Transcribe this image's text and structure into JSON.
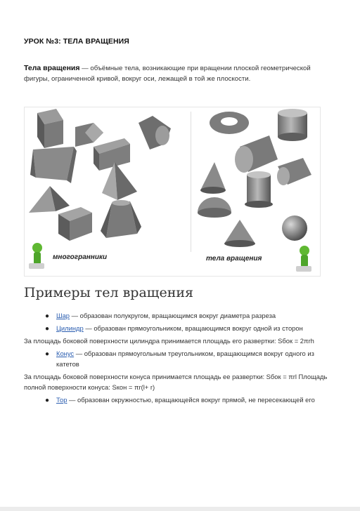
{
  "lesson_title": "УРОК №3: ТЕЛА ВРАЩЕНИЯ",
  "intro": {
    "term": "Тела вращения",
    "definition": " — объёмные тела, возникающие при вращении плоской геометрической фигуры, ограниченной кривой, вокруг оси, лежащей в той же плоскости."
  },
  "figure": {
    "left_caption": "многогранники",
    "right_caption": "тела вращения",
    "colors": {
      "shape_dark": "#555555",
      "shape_mid": "#8a8a8a",
      "shape_light": "#b8b8b8",
      "mascot_green": "#5fb832"
    }
  },
  "section_heading": "Примеры тел вращения",
  "bullets": [
    {
      "link": "Шар",
      "text": " — образован полукругом, вращающимся вокруг диаметра разреза"
    },
    {
      "link": "Цилиндр",
      "text": " — образован прямоугольником, вращающимся вокруг одной из сторон"
    }
  ],
  "para1": "За площадь боковой поверхности цилиндра принимается площадь его развертки: Sбок = 2πrh",
  "bullet3": {
    "link": "Конус",
    "text": " — образован прямоугольным треугольником, вращающимся вокруг одного из катетов"
  },
  "para2": "За площадь боковой поверхности конуса принимается площадь ее развертки: Sбок = πrl Площадь полной поверхности конуса: Sкон = πr(l+ r)",
  "bullet4": {
    "link": "Тор",
    "text": " — образован окружностью, вращающейся вокруг прямой, не пересекающей его"
  }
}
